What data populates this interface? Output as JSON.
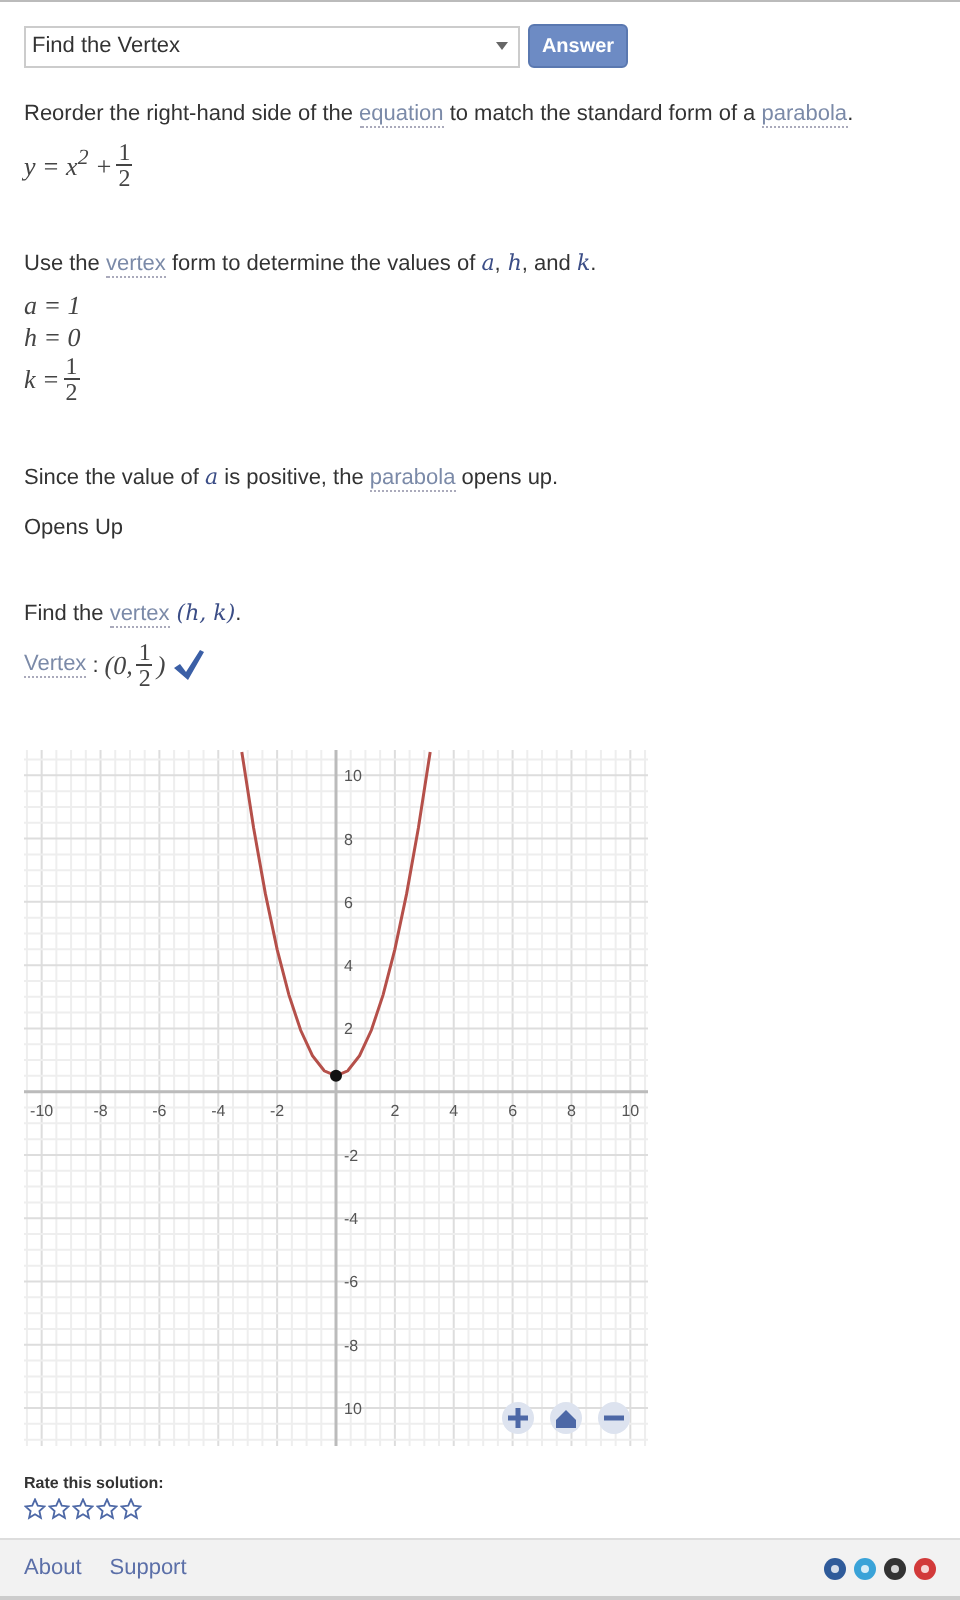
{
  "problem_select": {
    "value": "Find the Vertex"
  },
  "answer_button": "Answer",
  "steps": [
    {
      "sentence": [
        {
          "kind": "text",
          "text": "Reorder the right-hand side of the "
        },
        {
          "kind": "link",
          "text": "equation"
        },
        {
          "kind": "text",
          "text": " to match the standard form of a "
        },
        {
          "kind": "link",
          "text": "parabola"
        },
        {
          "kind": "text",
          "text": "."
        }
      ],
      "math": [
        [
          {
            "kind": "text",
            "text": "y = x$^{2}$ + "
          },
          {
            "kind": "frac",
            "num": "1",
            "den": "2"
          }
        ]
      ]
    },
    {
      "sentence": [
        {
          "kind": "text",
          "text": "Use the "
        },
        {
          "kind": "link",
          "text": "vertex"
        },
        {
          "kind": "text",
          "text": " form to determine the values of "
        },
        {
          "kind": "math",
          "text": "a"
        },
        {
          "kind": "text",
          "text": ","
        },
        {
          "kind": "math",
          "text": "h"
        },
        {
          "kind": "text",
          "text": ", and "
        },
        {
          "kind": "math",
          "text": "k"
        },
        {
          "kind": "text",
          "text": "."
        }
      ],
      "math": [
        [
          {
            "kind": "text",
            "text": "a = 1"
          }
        ],
        [
          {
            "kind": "text",
            "text": "h = 0"
          }
        ],
        [
          {
            "kind": "text",
            "text": "k = "
          },
          {
            "kind": "frac",
            "num": "1",
            "den": "2"
          }
        ]
      ]
    },
    {
      "sentence": [
        {
          "kind": "text",
          "text": "Since the value of "
        },
        {
          "kind": "math",
          "text": "a"
        },
        {
          "kind": "text",
          "text": " is positive, the "
        },
        {
          "kind": "link",
          "text": "parabola"
        },
        {
          "kind": "text",
          "text": " opens up."
        }
      ],
      "result": "Opens Up"
    },
    {
      "sentence": [
        {
          "kind": "text",
          "text": "Find the "
        },
        {
          "kind": "link",
          "text": "vertex"
        },
        {
          "kind": "math",
          "text": "(h, k)"
        },
        {
          "kind": "text",
          "text": "."
        }
      ],
      "answer": {
        "label": "Vertex",
        "separator": ":",
        "math": [
          {
            "kind": "text",
            "text": "(0, "
          },
          {
            "kind": "frac",
            "num": "1",
            "den": "2"
          },
          {
            "kind": "text",
            "text": ")"
          }
        ],
        "correct": true
      }
    }
  ],
  "graph": {
    "chart_data": {
      "type": "line",
      "grid": true,
      "xlim": [
        -10.6,
        10.6
      ],
      "ylim": [
        -11.2,
        10.8
      ],
      "xticks": [
        -10,
        -8,
        -6,
        -4,
        -2,
        2,
        4,
        6,
        8,
        10
      ],
      "yticks": [
        {
          "value": 10,
          "label": "10"
        },
        8,
        6,
        4,
        2,
        -2,
        -4,
        -6,
        -8,
        {
          "value": -10,
          "label": "10"
        }
      ],
      "x": [
        -3.2,
        -2.8,
        -2.4,
        -2,
        -1.6,
        -1.2,
        -0.8,
        -0.4,
        0,
        0.4,
        0.8,
        1.2,
        1.6,
        2,
        2.4,
        2.8,
        3.2
      ],
      "series": [
        {
          "color": "#b5504a",
          "values": [
            10.74,
            8.34,
            6.26,
            4.5,
            3.06,
            1.94,
            1.14,
            0.66,
            0.5,
            0.66,
            1.14,
            1.94,
            3.06,
            4.5,
            6.26,
            8.34,
            10.74
          ]
        }
      ]
    }
  },
  "rating": {
    "label": "Rate this solution:",
    "stars": 0
  },
  "footer": {
    "links": [
      "About",
      "Support"
    ]
  }
}
